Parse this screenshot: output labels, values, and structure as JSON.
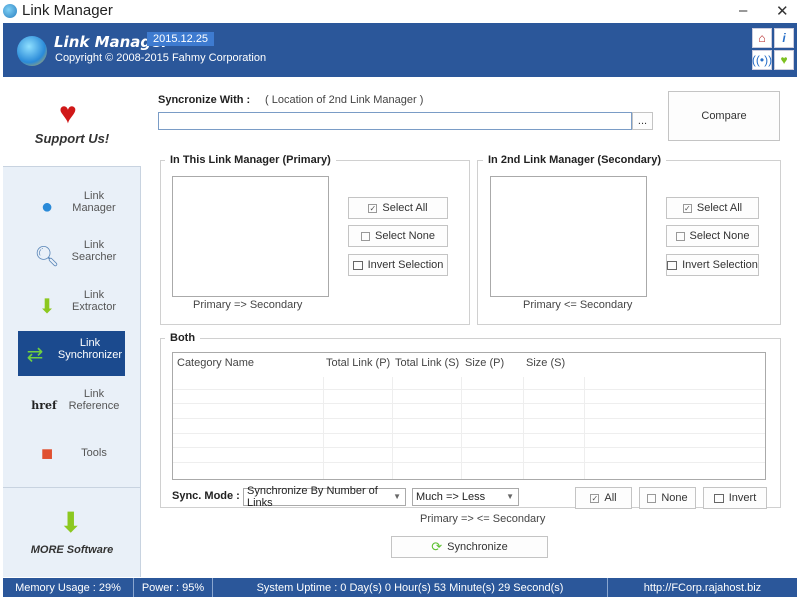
{
  "window": {
    "title": "Link Manager",
    "minimize": "–",
    "close": "✕"
  },
  "header": {
    "app_name": "Link Manager",
    "version": "2015.12.25",
    "copyright": "Copyright © 2008-2015 Fahmy Corporation",
    "icons": [
      "home-icon",
      "info-icon",
      "broadcast-icon",
      "heart-plus-icon"
    ]
  },
  "sidebar": {
    "support": "Support Us!",
    "more": "MORE Software",
    "items": [
      {
        "line1": "Link",
        "line2": "Manager",
        "icon": "globe-icon"
      },
      {
        "line1": "Link",
        "line2": "Searcher",
        "icon": "magnifier-icon"
      },
      {
        "line1": "Link",
        "line2": "Extractor",
        "icon": "download-icon"
      },
      {
        "line1": "Link",
        "line2": "Synchronizer",
        "icon": "sync-icon",
        "active": true
      },
      {
        "line1": "Link",
        "line2": "Reference",
        "icon": "href-icon",
        "icon_text": "href"
      },
      {
        "line1": "Tools",
        "line2": "",
        "icon": "cubes-icon"
      }
    ]
  },
  "sync": {
    "label": "Syncronize With :",
    "hint": "( Location of 2nd Link Manager )",
    "value": "",
    "browse": "...",
    "compare": "Compare"
  },
  "primary": {
    "title": "In This Link Manager (Primary)",
    "select_all": "Select All",
    "select_none": "Select None",
    "invert": "Invert Selection",
    "direction": "Primary => Secondary"
  },
  "secondary": {
    "title": "In 2nd Link Manager (Secondary)",
    "select_all": "Select All",
    "select_none": "Select None",
    "invert": "Invert Selection",
    "direction": "Primary <= Secondary"
  },
  "both": {
    "title": "Both",
    "table": {
      "columns": [
        "Category Name",
        "Total Link (P)",
        "Total Link (S)",
        "Size (P)",
        "Size (S)"
      ],
      "rows": []
    },
    "mode_label": "Sync. Mode :",
    "mode_value": "Synchronize By Number of Links",
    "order_value": "Much => Less",
    "all": "All",
    "none": "None",
    "invert": "Invert",
    "direction": "Primary => <= Secondary"
  },
  "synchronize": "Synchronize",
  "status": {
    "memory": "Memory Usage : 29%",
    "power": "Power : 95%",
    "uptime": "System Uptime : 0 Day(s) 0 Hour(s) 53 Minute(s) 29 Second(s)",
    "url": "http://FCorp.rajahost.biz"
  },
  "colors": {
    "header": "#2b579a",
    "active_nav": "#1b4a8e",
    "sidebar": "#e9f0f8"
  }
}
